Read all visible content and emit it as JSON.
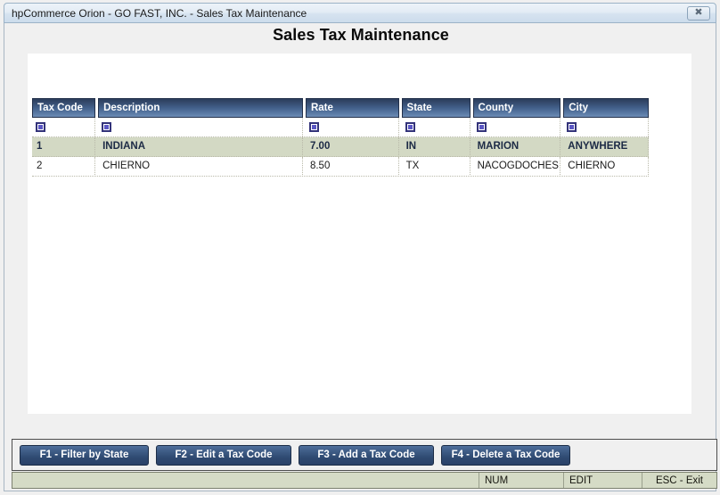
{
  "window": {
    "title": "hpCommerce Orion - GO FAST, INC. - Sales Tax Maintenance",
    "close_glyph": "✖"
  },
  "page": {
    "heading": "Sales Tax Maintenance"
  },
  "grid": {
    "columns": [
      {
        "label": "Tax Code"
      },
      {
        "label": "Description"
      },
      {
        "label": "Rate"
      },
      {
        "label": "State"
      },
      {
        "label": "County"
      },
      {
        "label": "City"
      }
    ],
    "filter_row": {
      "icon_name": "filter-icon",
      "cells": [
        "",
        "",
        "",
        "",
        "",
        ""
      ]
    },
    "rows": [
      {
        "selected": true,
        "cells": [
          "1",
          "INDIANA",
          "7.00",
          "IN",
          "MARION",
          "ANYWHERE"
        ]
      },
      {
        "selected": false,
        "cells": [
          "2",
          "CHIERNO",
          "8.50",
          "TX",
          "NACOGDOCHES",
          "CHIERNO"
        ]
      }
    ]
  },
  "buttons": [
    {
      "label": "F1 - Filter by State"
    },
    {
      "label": "F2 - Edit a Tax Code"
    },
    {
      "label": "F3 - Add a Tax Code"
    },
    {
      "label": "F4 - Delete a Tax Code"
    }
  ],
  "status_bar": {
    "main": "",
    "num": "NUM",
    "edit": "EDIT",
    "esc": "ESC - Exit"
  },
  "colors": {
    "header_blue_dark": "#2b3d5c",
    "header_blue_light": "#6d8cb5",
    "selected_row": "#d3d9c4",
    "status_bar_bg": "#d5dbc6",
    "button_blue": "#3f5d87",
    "window_bg": "#f0f0f0",
    "filter_icon_inner": "#5b57c4"
  }
}
